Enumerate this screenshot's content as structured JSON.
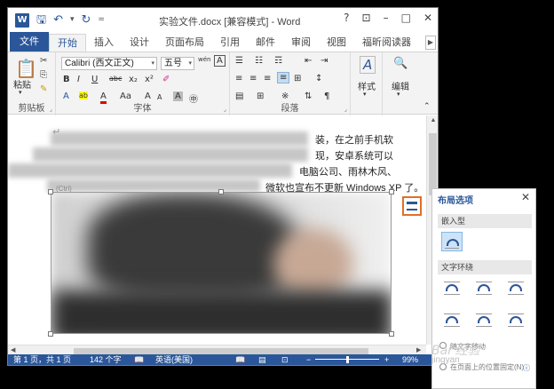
{
  "window": {
    "title": "实验文件.docx [兼容模式] - Word",
    "logo": "W",
    "controls": [
      "?",
      "⊡",
      "–",
      "□",
      "✕"
    ]
  },
  "qat": {
    "save_icon": "save-icon",
    "undo": "↶",
    "undo_dd": "▾",
    "redo": "↻",
    "customize": "="
  },
  "tabs": [
    {
      "label": "文件"
    },
    {
      "label": "开始"
    },
    {
      "label": "插入"
    },
    {
      "label": "设计"
    },
    {
      "label": "页面布局"
    },
    {
      "label": "引用"
    },
    {
      "label": "邮件"
    },
    {
      "label": "审阅"
    },
    {
      "label": "视图"
    },
    {
      "label": "福昕阅读器"
    }
  ],
  "ribbon": {
    "clipboard": {
      "label": "剪贴板",
      "paste": "粘贴",
      "paste_dd": "▾",
      "cut": "✂",
      "copy": "⎘",
      "format_painter": "✎",
      "launcher": "⌟"
    },
    "font": {
      "label": "字体",
      "font_name": "Calibri (西文正文)",
      "font_size": "五号",
      "dd": "▾",
      "grow": "wén",
      "clear": "A",
      "bold": "B",
      "italic": "I",
      "underline": "U",
      "strike": "abc",
      "sub": "x₂",
      "sup": "x²",
      "eraser": "✐",
      "effects": "A",
      "highlight": "ab",
      "color": "A",
      "case": "Aa",
      "grow_font": "A",
      "shrink_font": "A",
      "char_shade": "A",
      "enclosed": "㊥",
      "launcher": "⌟"
    },
    "paragraph": {
      "label": "段落",
      "bullets": "☰",
      "numbering": "☷",
      "multilevel": "☶",
      "dec_indent": "⇤",
      "inc_indent": "⇥",
      "align_left": "≡",
      "align_center": "≡",
      "align_right": "≡",
      "justify": "≡",
      "distributed": "⊞",
      "line_spacing": "↕",
      "shading": "▤",
      "borders": "⊞",
      "chinese_layout": "※",
      "sort": "⇅",
      "show_marks": "¶",
      "launcher": "⌟"
    },
    "styles": {
      "label": "样式",
      "icon": "A"
    },
    "editing": {
      "label": "编辑",
      "icon": "🔭"
    },
    "collapse": "⌃"
  },
  "document": {
    "line1": "装，在之前手机软",
    "line2": "现，安卓系统可以",
    "line3": "电脑公司、雨林木风、",
    "line4": "微软也宣布不更新 Windows XP 了。",
    "para_mark": "↵",
    "ctrl_label": "(Ctrl)"
  },
  "scrollbars": {
    "up": "▲",
    "down": "▼",
    "left": "◀",
    "right": "▶"
  },
  "status": {
    "page": "第 1 页，共 1 页",
    "words": "142 个字",
    "proof_icon": "proofing-icon",
    "language": "英语(美国)",
    "zoom_minus": "−",
    "zoom_plus": "+",
    "zoom": "99%",
    "zoom_fraction": 0.5
  },
  "layout_pane": {
    "title": "布局选项",
    "close": "✕",
    "inline_section": "嵌入型",
    "wrap_section": "文字环绕",
    "move_with_text": "随文字移动",
    "fix_on_page": "在页面上的位置固定(N)",
    "info": "ⓘ"
  },
  "watermark": {
    "text": "Bai 经验",
    "sub": "jingyan"
  }
}
